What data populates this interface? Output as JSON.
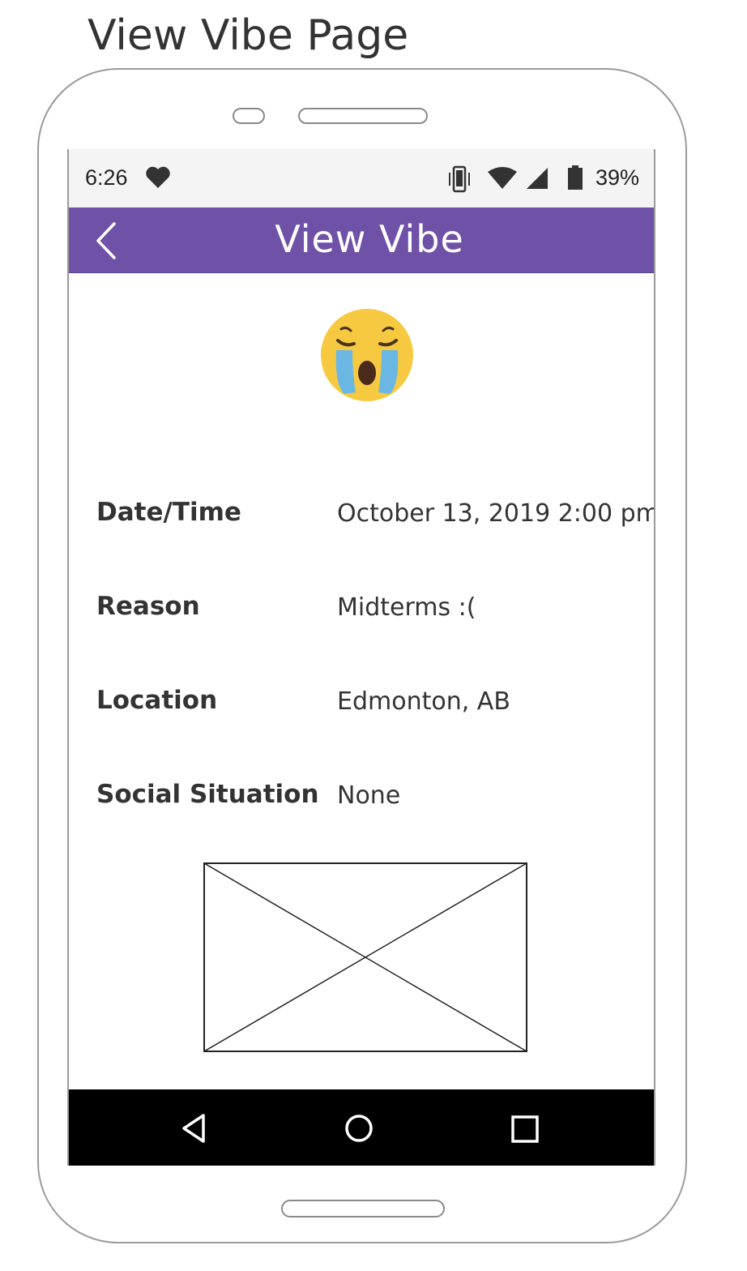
{
  "page": {
    "title": "View Vibe Page"
  },
  "status_bar": {
    "time": "6:26",
    "battery": "39%"
  },
  "app_bar": {
    "title": "View Vibe"
  },
  "vibe": {
    "mood_icon": "loudly-crying-face-emoji",
    "details": [
      {
        "label": "Date/Time",
        "value": "October 13, 2019  2:00 pm"
      },
      {
        "label": "Reason",
        "value": "Midterms :("
      },
      {
        "label": "Location",
        "value": "Edmonton, AB"
      },
      {
        "label": "Social Situation",
        "value": "None"
      }
    ]
  },
  "colors": {
    "app_bar": "#6f52a7",
    "nav_bar": "#000000",
    "status_bar": "#f4f4f4"
  },
  "icons": {
    "status": [
      "heart-icon",
      "vibrate-icon",
      "wifi-icon",
      "signal-icon",
      "battery-icon"
    ],
    "nav": [
      "nav-back-icon",
      "nav-home-icon",
      "nav-recents-icon"
    ]
  }
}
